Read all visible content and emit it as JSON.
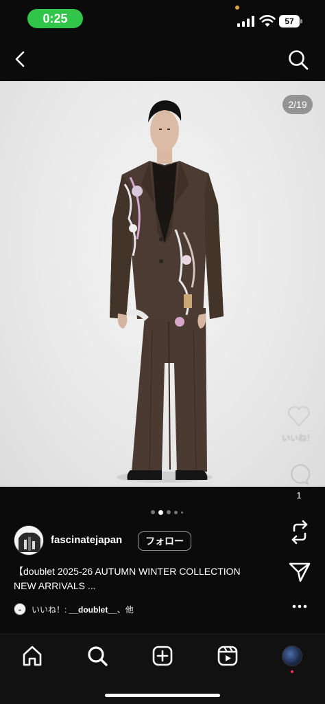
{
  "status_bar": {
    "time": "0:25",
    "battery": "57"
  },
  "photo": {
    "counter": "2/19",
    "like_label": "いいね！",
    "comment_count": "1"
  },
  "post": {
    "username": "fascinatejapan",
    "follow_label": "フォロー",
    "caption_line1": "【doublet 2025-26 AUTUMN WINTER COLLECTION",
    "caption_line2": "NEW ARRIVALS ...",
    "likes_prefix": "いいね！: ",
    "likes_user": "__doublet__",
    "likes_suffix": "、他",
    "carousel": {
      "count": 5,
      "active_index": 1
    }
  },
  "colors": {
    "accent_green": "#31c54a",
    "background": "#0b0b0b",
    "notification_red": "#ff2d55"
  },
  "icons": [
    "back-icon",
    "search-icon",
    "heart-icon",
    "comment-icon",
    "repost-icon",
    "share-icon",
    "more-icon",
    "home-icon",
    "create-icon",
    "reels-icon"
  ]
}
